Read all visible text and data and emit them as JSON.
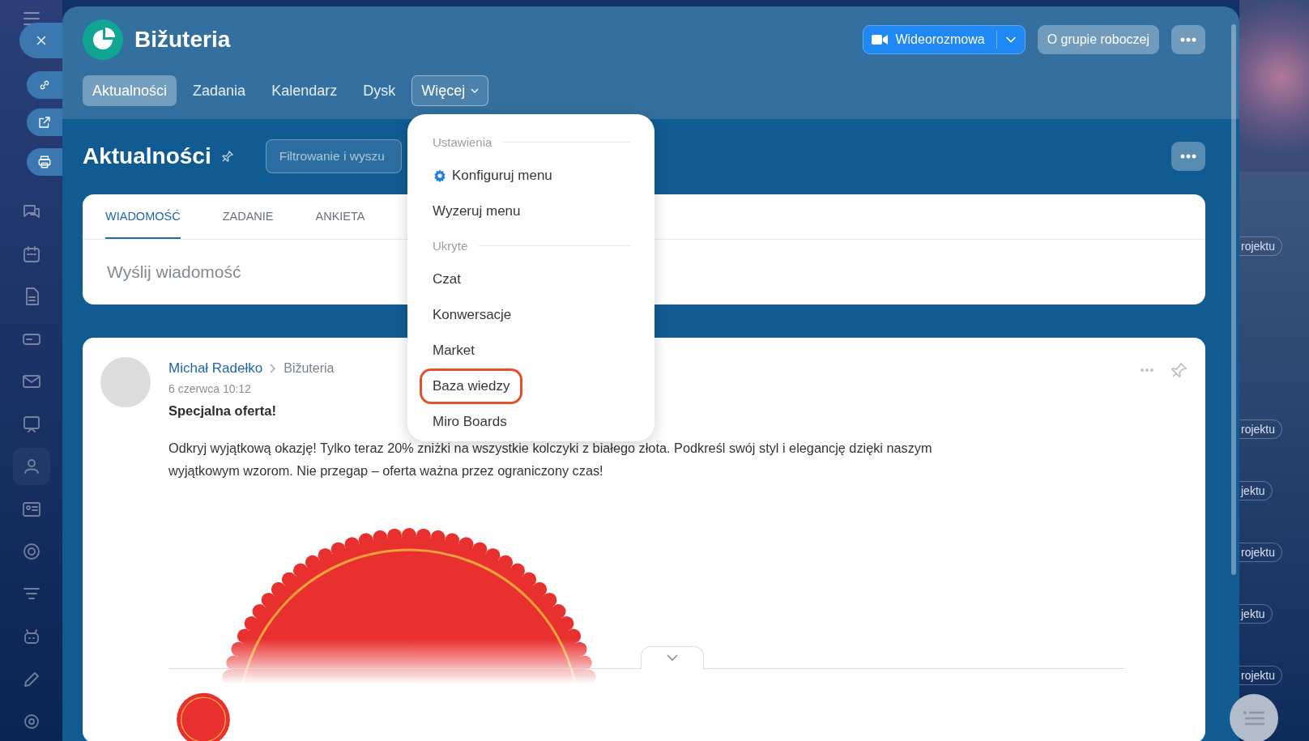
{
  "window": {
    "title": "Bižuteria"
  },
  "left_sidebar": {
    "items": [
      {
        "selected": false
      },
      {
        "selected": false
      },
      {
        "selected": false
      },
      {
        "selected": false
      },
      {
        "selected": false
      },
      {
        "selected": false
      },
      {
        "selected": false
      },
      {
        "selected": true
      },
      {
        "selected": false
      },
      {
        "selected": false
      },
      {
        "selected": false
      },
      {
        "selected": false
      },
      {
        "selected": false
      },
      {
        "selected": false
      }
    ]
  },
  "slider_actions": [
    {
      "kind": "close"
    },
    {
      "kind": "link"
    },
    {
      "kind": "open"
    },
    {
      "kind": "print"
    }
  ],
  "header_buttons": [
    {
      "kind": "video",
      "label": "Wideorozmowa"
    },
    {
      "kind": "plain",
      "label": "O grupie roboczej"
    },
    {
      "kind": "more"
    }
  ],
  "tabs": [
    {
      "label": "Aktualności",
      "kind": "link",
      "selected": true
    },
    {
      "label": "Zadania",
      "kind": "link",
      "selected": false
    },
    {
      "label": "Kalendarz",
      "kind": "link",
      "selected": false
    },
    {
      "label": "Dysk",
      "kind": "link",
      "selected": false
    },
    {
      "label": "Więcej",
      "kind": "menu",
      "selected": false,
      "expanded": true
    }
  ],
  "page": {
    "heading": "Aktualności",
    "filter": {
      "placeholder": "Filtrowanie i wyszu"
    }
  },
  "composer": {
    "tabs": [
      {
        "label": "WIADOMOŚĆ",
        "selected": true
      },
      {
        "label": "ZADANIE",
        "selected": false
      },
      {
        "label": "ANKIETA",
        "selected": false
      }
    ],
    "placeholder": "Wyślij wiadomość"
  },
  "post": {
    "author": "Michał Radełko",
    "destination": "Bižuteria",
    "date": "6 czerwca 10:12",
    "title": "Specjalna oferta!",
    "body": "Odkryj wyjątkową okazję! Tylko teraz 20% zniżki na wszystkie kolczyki z białego złota. Podkreśl swój styl i elegancję dzięki naszym wyjątkowym wzorom. Nie przegap – oferta ważna przez ograniczony czas!"
  },
  "menu": {
    "items": [
      {
        "kind": "heading",
        "label": "Ustawienia"
      },
      {
        "kind": "setting",
        "label": "Konfiguruj menu",
        "highlighted": false
      },
      {
        "kind": "item",
        "label": "Wyzeruj menu",
        "highlighted": false
      },
      {
        "kind": "heading",
        "label": "Ukryte"
      },
      {
        "kind": "item",
        "label": "Czat",
        "highlighted": false
      },
      {
        "kind": "item",
        "label": "Konwersacje",
        "highlighted": false
      },
      {
        "kind": "item",
        "label": "Market",
        "highlighted": false
      },
      {
        "kind": "item",
        "label": "Baza wiedzy",
        "highlighted": true
      },
      {
        "kind": "item",
        "label": "Miro Boards",
        "highlighted": false
      }
    ]
  },
  "background_tags": [
    "rojektu",
    "rojektu",
    "jektu",
    "rojektu",
    "jektu",
    "rojektu"
  ]
}
